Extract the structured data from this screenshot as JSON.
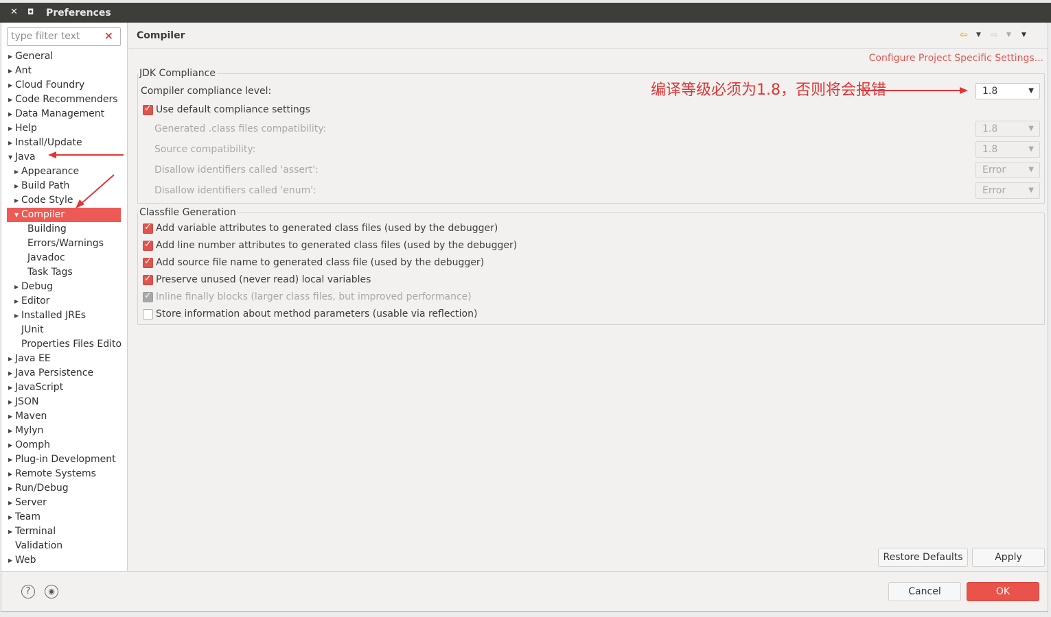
{
  "window": {
    "title": "Preferences",
    "close_glyph": "✕",
    "max_glyph": "◘"
  },
  "filter": {
    "placeholder": "type filter text",
    "clear_glyph": "✕"
  },
  "tree": [
    {
      "label": "General",
      "arrow": "▶"
    },
    {
      "label": "Ant",
      "arrow": "▶"
    },
    {
      "label": "Cloud Foundry",
      "arrow": "▶"
    },
    {
      "label": "Code Recommenders",
      "arrow": "▶"
    },
    {
      "label": "Data Management",
      "arrow": "▶"
    },
    {
      "label": "Help",
      "arrow": "▶"
    },
    {
      "label": "Install/Update",
      "arrow": "▶"
    },
    {
      "label": "Java",
      "arrow": "▼"
    },
    {
      "label": "Appearance",
      "arrow": "▶"
    },
    {
      "label": "Build Path",
      "arrow": "▶"
    },
    {
      "label": "Code Style",
      "arrow": "▶"
    },
    {
      "label": "Compiler",
      "arrow": "▼"
    },
    {
      "label": "Building",
      "arrow": ""
    },
    {
      "label": "Errors/Warnings",
      "arrow": ""
    },
    {
      "label": "Javadoc",
      "arrow": ""
    },
    {
      "label": "Task Tags",
      "arrow": ""
    },
    {
      "label": "Debug",
      "arrow": "▶"
    },
    {
      "label": "Editor",
      "arrow": "▶"
    },
    {
      "label": "Installed JREs",
      "arrow": "▶"
    },
    {
      "label": "JUnit",
      "arrow": ""
    },
    {
      "label": "Properties Files Edito",
      "arrow": ""
    },
    {
      "label": "Java EE",
      "arrow": "▶"
    },
    {
      "label": "Java Persistence",
      "arrow": "▶"
    },
    {
      "label": "JavaScript",
      "arrow": "▶"
    },
    {
      "label": "JSON",
      "arrow": "▶"
    },
    {
      "label": "Maven",
      "arrow": "▶"
    },
    {
      "label": "Mylyn",
      "arrow": "▶"
    },
    {
      "label": "Oomph",
      "arrow": "▶"
    },
    {
      "label": "Plug-in Development",
      "arrow": "▶"
    },
    {
      "label": "Remote Systems",
      "arrow": "▶"
    },
    {
      "label": "Run/Debug",
      "arrow": "▶"
    },
    {
      "label": "Server",
      "arrow": "▶"
    },
    {
      "label": "Team",
      "arrow": "▶"
    },
    {
      "label": "Terminal",
      "arrow": "▶"
    },
    {
      "label": "Validation",
      "arrow": ""
    },
    {
      "label": "Web",
      "arrow": "▶"
    }
  ],
  "page": {
    "title": "Compiler",
    "project_link": "Configure Project Specific Settings...",
    "nav": {
      "back": "⇦",
      "forward": "⇨",
      "dropdown": "▼",
      "menu": "▼"
    }
  },
  "jdk": {
    "legend": "JDK Compliance",
    "level_label": "Compiler compliance level:",
    "level_value": "1.8",
    "use_default_label": "Use default compliance settings",
    "use_default_checked": true,
    "generated_label": "Generated .class files compatibility:",
    "generated_value": "1.8",
    "source_label": "Source compatibility:",
    "source_value": "1.8",
    "assert_label": "Disallow identifiers called 'assert':",
    "assert_value": "Error",
    "enum_label": "Disallow identifiers called 'enum':",
    "enum_value": "Error"
  },
  "classfile": {
    "legend": "Classfile Generation",
    "options": [
      {
        "label": "Add variable attributes to generated class files (used by the debugger)",
        "state": "on"
      },
      {
        "label": "Add line number attributes to generated class files (used by the debugger)",
        "state": "on"
      },
      {
        "label": "Add source file name to generated class file (used by the debugger)",
        "state": "on"
      },
      {
        "label": "Preserve unused (never read) local variables",
        "state": "on"
      },
      {
        "label": "Inline finally blocks (larger class files, but improved performance)",
        "state": "disabled"
      },
      {
        "label": "Store information about method parameters (usable via reflection)",
        "state": "off"
      }
    ]
  },
  "annotation": {
    "text": "编译等级必须为1.8，否则将会报错",
    "color": "#e23434"
  },
  "buttons": {
    "restore_defaults": "Restore Defaults",
    "apply": "Apply",
    "cancel": "Cancel",
    "ok": "OK"
  },
  "footer_icons": {
    "help": "?",
    "import": "◉"
  },
  "colors": {
    "accent": "#ed5a55",
    "link": "#e0574f"
  }
}
